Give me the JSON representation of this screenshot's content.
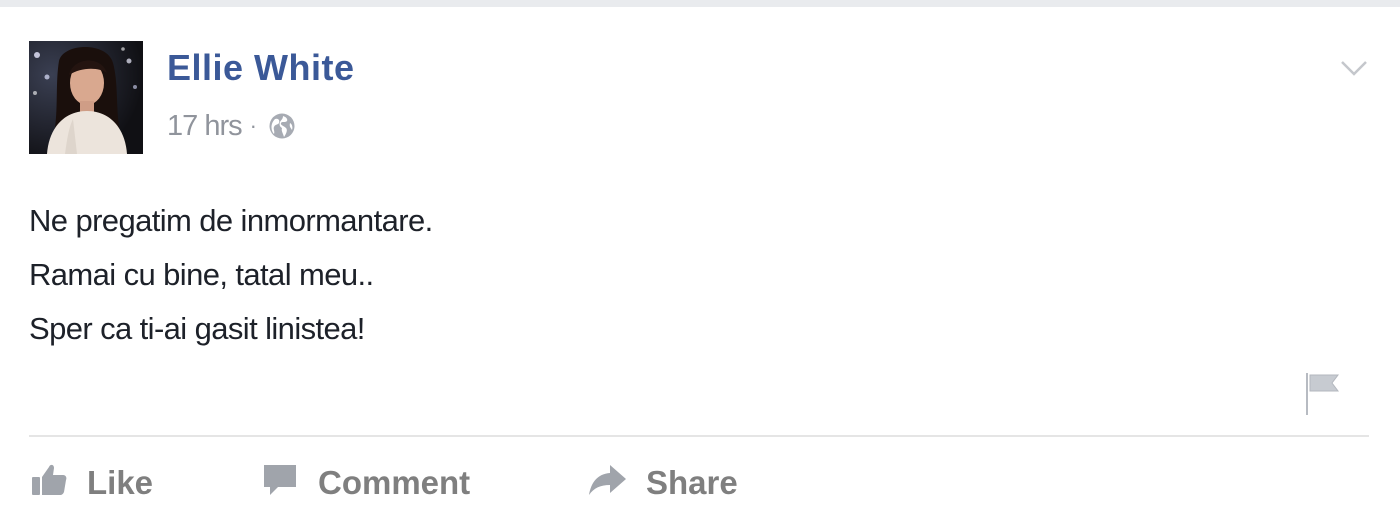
{
  "post": {
    "author": "Ellie White",
    "time": "17 hrs",
    "separator": "·",
    "privacy_icon": "globe-icon",
    "options_icon": "chevron-down-icon",
    "report_icon": "flag-icon",
    "lines": [
      "Ne pregatim de inmormantare.",
      "Ramai cu bine, tatal meu..",
      "Sper ca ti-ai gasit linistea!"
    ]
  },
  "actions": {
    "like_label": "Like",
    "comment_label": "Comment",
    "share_label": "Share"
  },
  "colors": {
    "author_link": "#3b5998",
    "meta_text": "#90949c",
    "action_text": "#7f7f7f",
    "body_text": "#1d2129",
    "divider": "#e5e5e5",
    "page_background_strip": "#e9ebee"
  }
}
